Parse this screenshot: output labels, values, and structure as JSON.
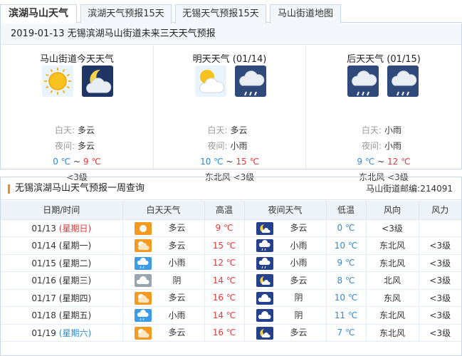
{
  "tabs": [
    {
      "label": "滨湖马山天气"
    },
    {
      "label": "滨湖天气预报15天"
    },
    {
      "label": "无锡天气预报15天"
    },
    {
      "label": "马山街道地图"
    }
  ],
  "forecast": {
    "title": "2019-01-13 无锡滨湖马山街道未来三天天气预报",
    "labels": {
      "day": "白天:",
      "night": "夜间:",
      "sep": "~"
    },
    "days": [
      {
        "head": "马山街道今天天气",
        "day_icon": "sun-icon",
        "night_icon": "moon-cloud-icon",
        "day": "多云",
        "night": "多云",
        "low": "0 ℃",
        "high": "9 ℃",
        "wind": "<3级"
      },
      {
        "head": "明天天气 (01/14)",
        "day_icon": "sun-cloud-icon",
        "night_icon": "rain-cloud-icon",
        "day": "多云",
        "night": "小雨",
        "low": "10 ℃",
        "high": "15 ℃",
        "wind": "东北风 <3级"
      },
      {
        "head": "后天天气 (01/15)",
        "day_icon": "rain-cloud-icon",
        "night_icon": "rain-cloud-icon",
        "day": "小雨",
        "night": "小雨",
        "low": "9 ℃",
        "high": "12 ℃",
        "wind": "东北风 <3级"
      }
    ]
  },
  "week": {
    "title": "无锡滨湖马山天气预报一周查询",
    "zip_label": "马山街道邮编:",
    "zip": "214091",
    "headers": [
      "日期/时间",
      "白天天气",
      "高温",
      "夜间天气",
      "低温",
      "风向",
      "风力"
    ],
    "rows": [
      {
        "date": "01/13",
        "week": "(星期日)",
        "week_color": "red",
        "day_icon": "sun-icon",
        "day": "多云",
        "high": "9 ℃",
        "night_icon": "moon-cloud-icon",
        "night": "多云",
        "low": "0 ℃",
        "dir": "<3级",
        "force": ""
      },
      {
        "date": "01/14",
        "week": "(星期一)",
        "week_color": "normal",
        "day_icon": "sun-cloud-icon",
        "day": "多云",
        "high": "15 ℃",
        "night_icon": "rain-cloud-icon",
        "night": "小雨",
        "low": "10 ℃",
        "dir": "东北风",
        "force": "<3级"
      },
      {
        "date": "01/15",
        "week": "(星期二)",
        "week_color": "normal",
        "day_icon": "rain-cloud-icon",
        "day": "小雨",
        "high": "12 ℃",
        "night_icon": "rain-cloud-icon",
        "night": "小雨",
        "low": "9 ℃",
        "dir": "东北风",
        "force": "<3级"
      },
      {
        "date": "01/16",
        "week": "(星期三)",
        "week_color": "normal",
        "day_icon": "overcast-icon",
        "day": "阴",
        "high": "14 ℃",
        "night_icon": "moon-cloud-icon",
        "night": "多云",
        "low": "8 ℃",
        "dir": "北风",
        "force": "<3级"
      },
      {
        "date": "01/17",
        "week": "(星期四)",
        "week_color": "normal",
        "day_icon": "sun-cloud-icon",
        "day": "多云",
        "high": "16 ℃",
        "night_icon": "overcast-icon",
        "night": "阴",
        "low": "10 ℃",
        "dir": "东风",
        "force": "<3级"
      },
      {
        "date": "01/18",
        "week": "(星期五)",
        "week_color": "normal",
        "day_icon": "rain-cloud-icon",
        "day": "小雨",
        "high": "14 ℃",
        "night_icon": "overcast-icon",
        "night": "阴",
        "low": "11 ℃",
        "dir": "东北风",
        "force": "<3级"
      },
      {
        "date": "01/19",
        "week": "(星期六)",
        "week_color": "blue",
        "day_icon": "sun-cloud-icon",
        "day": "多云",
        "high": "16 ℃",
        "night_icon": "moon-cloud-icon",
        "night": "多云",
        "low": "7 ℃",
        "dir": "东北风",
        "force": "<3级"
      }
    ]
  },
  "colors": {
    "high": "#e03a3a",
    "low": "#2c8bd6",
    "accent": "#f08a24",
    "border": "#c9d7e6"
  }
}
